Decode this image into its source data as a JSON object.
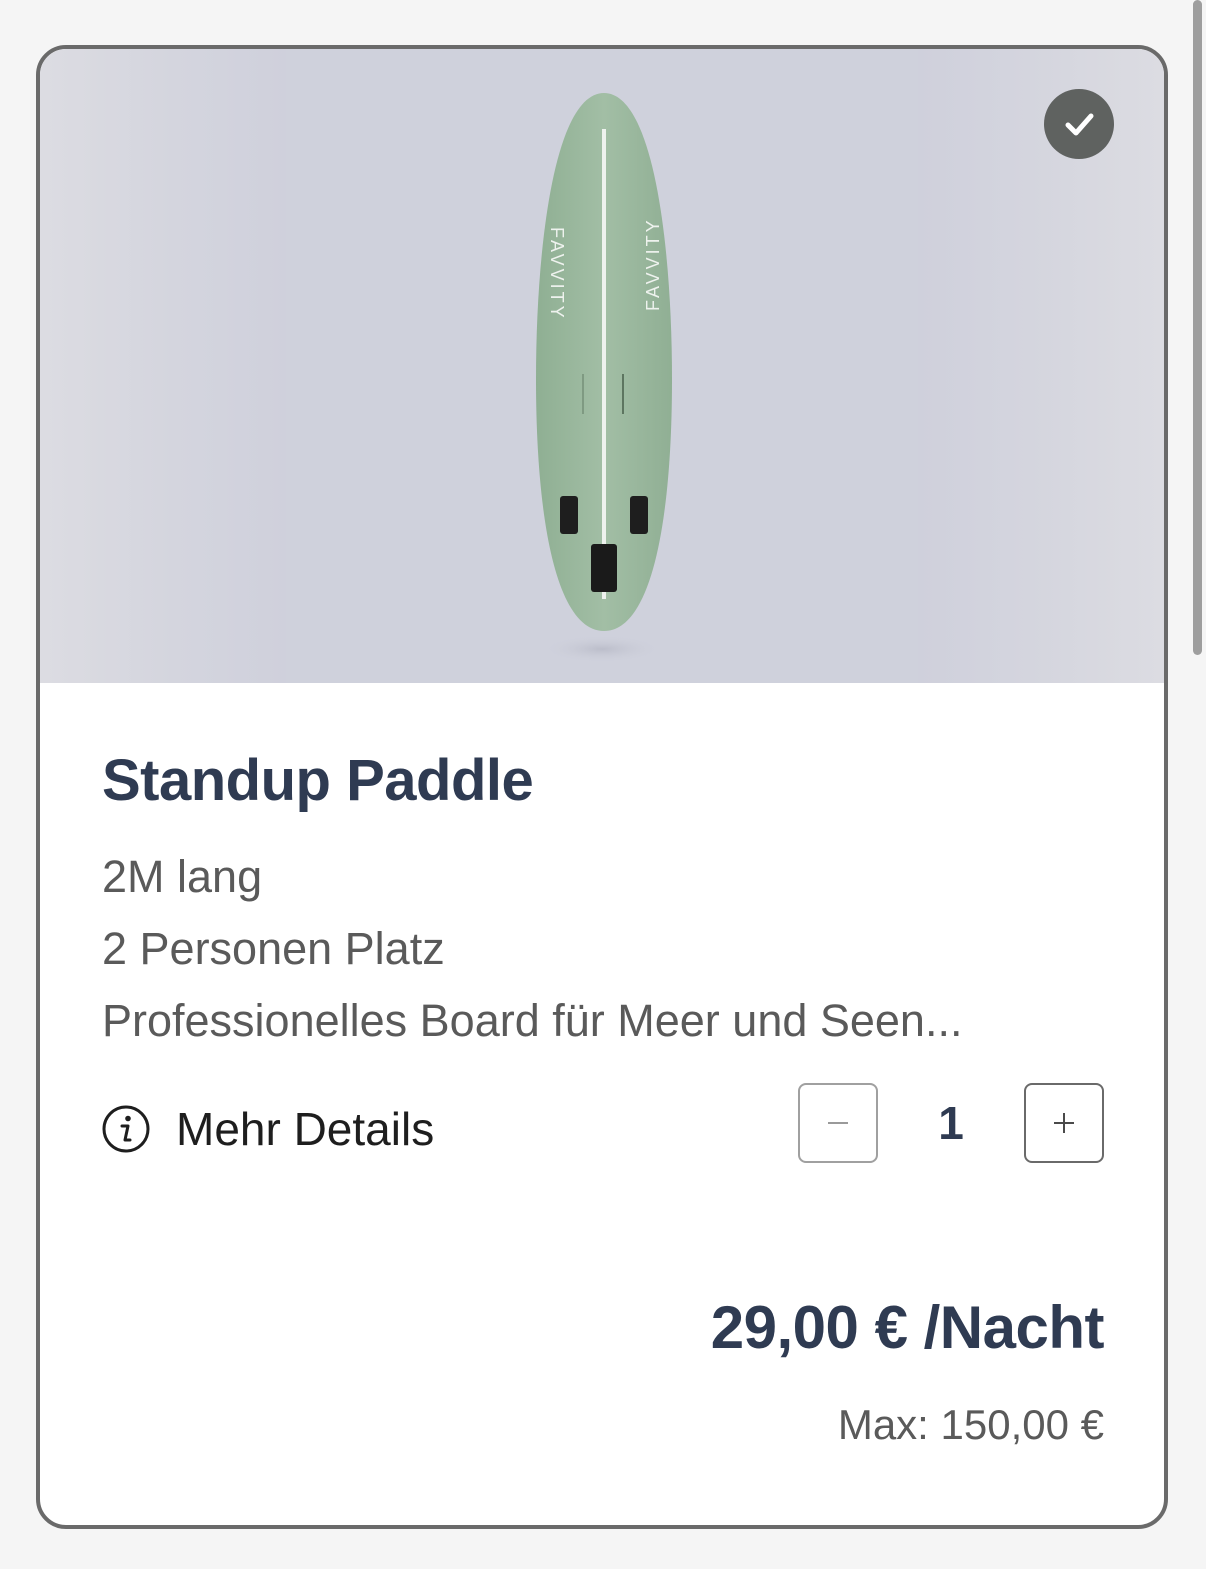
{
  "product": {
    "title": "Standup Paddle",
    "description_lines": [
      "2M lang",
      "2 Personen Platz",
      "Professionelles Board für Meer und Seen..."
    ],
    "image_brand_text": "FAVVITY",
    "selected": true
  },
  "details_link": {
    "label": "Mehr Details",
    "icon": "info-icon"
  },
  "quantity": {
    "value": "1",
    "decrement_icon": "minus-icon",
    "increment_icon": "plus-icon"
  },
  "pricing": {
    "price_label": "29,00 € /Nacht",
    "max_label": "Max: 150,00 €"
  },
  "colors": {
    "title": "#2f3b52",
    "board": "#9cb89f",
    "badge": "#5f6260"
  }
}
